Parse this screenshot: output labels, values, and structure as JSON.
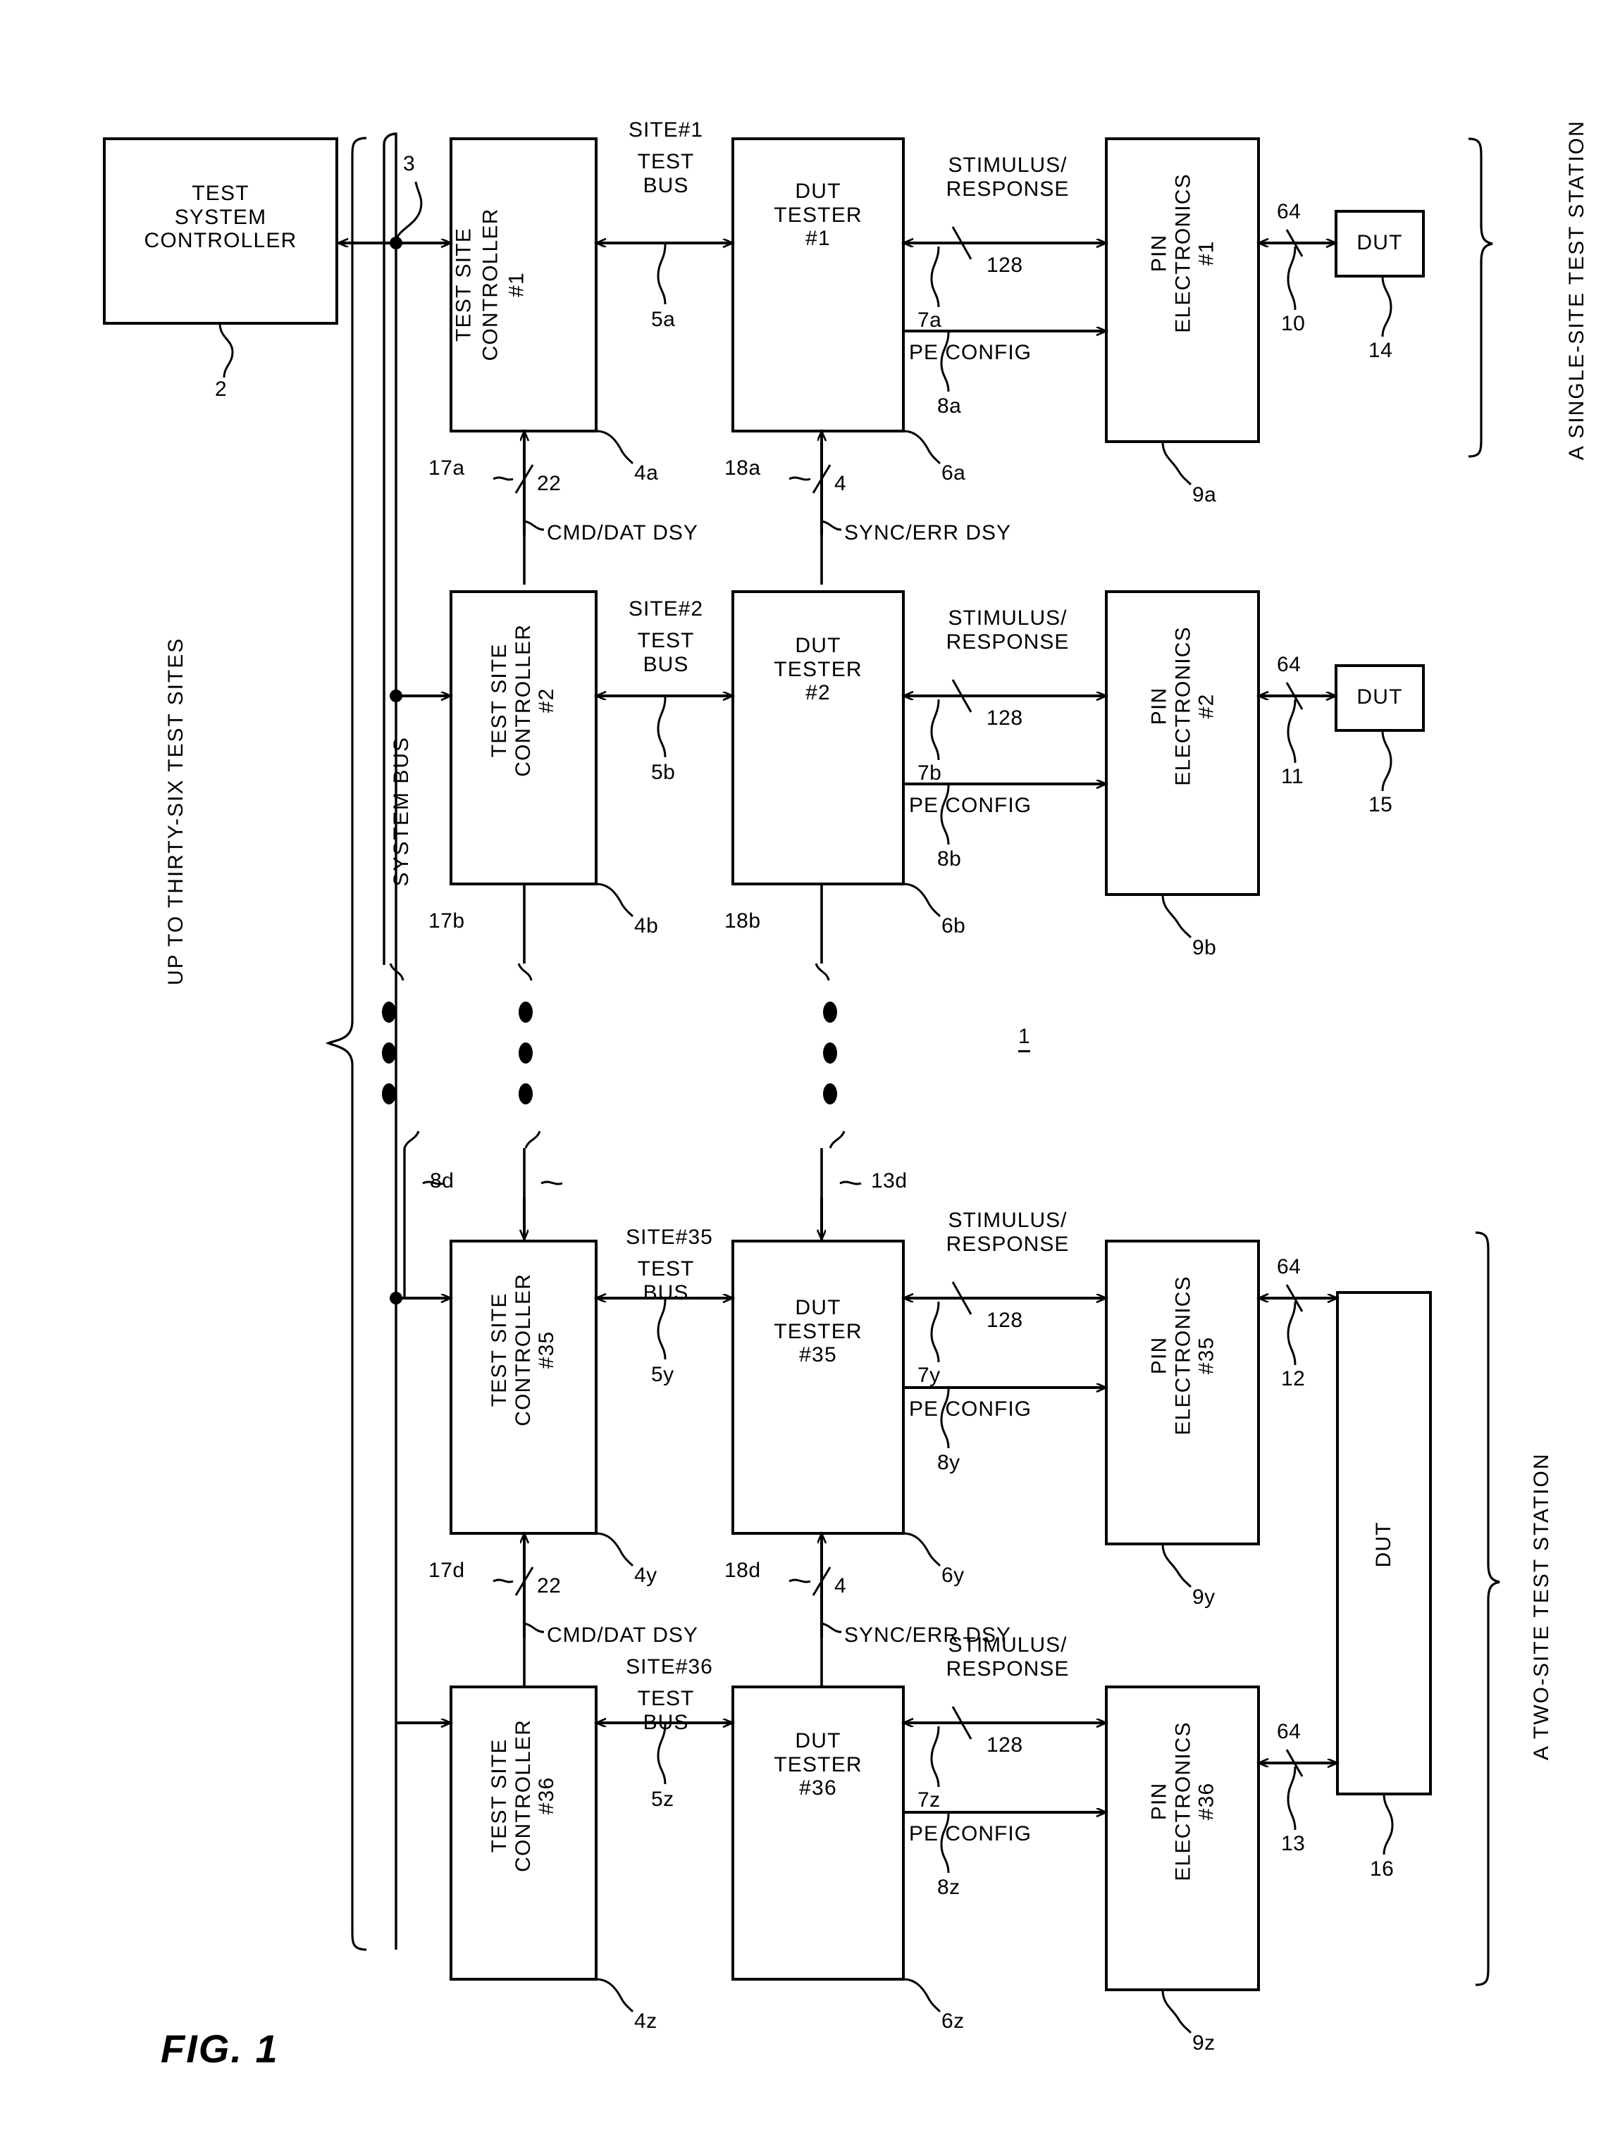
{
  "figure": {
    "caption": "FIG. 1",
    "system_ref": "1"
  },
  "system_controller": {
    "label": "TEST\nSYSTEM\nCONTROLLER",
    "ref": "2"
  },
  "system_bus": {
    "label": "SYSTEM BUS",
    "ref": "3",
    "sites_label": "UP TO THIRTY-SIX TEST SITES"
  },
  "signals": {
    "site_test_bus": "TEST\nBUS",
    "stimulus_response": "STIMULUS/\nRESPONSE",
    "stimulus_width": "128",
    "pe_config": "PE CONFIG",
    "dut_width": "64",
    "cmd_dat_dsy": "CMD/DAT DSY",
    "sync_err_dsy": "SYNC/ERR DSY",
    "cmd_dat_width": "22",
    "sync_err_width": "4",
    "dut_label": "DUT"
  },
  "stations": {
    "single": "A SINGLE-SITE TEST STATION",
    "two": "A TWO-SITE TEST STATION"
  },
  "rows": [
    {
      "site_title": "SITE#1",
      "controller": "TEST SITE\nCONTROLLER\n#1",
      "controller_ref": "4a",
      "tester": "DUT\nTESTER\n#1",
      "tester_ref": "6a",
      "pin": "PIN\nELECTRONICS\n#1",
      "pin_ref": "9a",
      "bus_ref": "5a",
      "sr_ref": "7a",
      "pe_ref": "8a",
      "dut_ref": "10",
      "dut": "DUT",
      "dut_block_ref": "14",
      "dsy_cmd_ref": "17a",
      "dsy_sync_ref": "18a"
    },
    {
      "site_title": "SITE#2",
      "controller": "TEST SITE\nCONTROLLER\n#2",
      "controller_ref": "4b",
      "tester": "DUT\nTESTER\n#2",
      "tester_ref": "6b",
      "pin": "PIN\nELECTRONICS\n#2",
      "pin_ref": "9b",
      "bus_ref": "5b",
      "sr_ref": "7b",
      "pe_ref": "8b",
      "dut_ref": "11",
      "dut": "DUT",
      "dut_block_ref": "15",
      "dsy_cmd_ref": "17b",
      "dsy_sync_ref": "18b"
    },
    {
      "site_title": "SITE#35",
      "controller": "TEST SITE\nCONTROLLER\n#35",
      "controller_ref": "4y",
      "tester": "DUT\nTESTER\n#35",
      "tester_ref": "6y",
      "pin": "PIN\nELECTRONICS\n#35",
      "pin_ref": "9y",
      "bus_ref": "5y",
      "sr_ref": "7y",
      "pe_ref": "8y",
      "dut_ref": "12",
      "dut": "DUT",
      "dut_block_ref": "16",
      "dsy_cmd_ref": "17d",
      "dsy_sync_ref": "18d"
    },
    {
      "site_title": "SITE#36",
      "controller": "TEST SITE\nCONTROLLER\n#36",
      "controller_ref": "4z",
      "tester": "DUT\nTESTER\n#36",
      "tester_ref": "6z",
      "pin": "PIN\nELECTRONICS\n#36",
      "pin_ref": "9z",
      "bus_ref": "5z",
      "sr_ref": "7z",
      "pe_ref": "8z",
      "dut_ref": "13",
      "dut": "DUT",
      "dut_block_ref": "",
      "dsy_cmd_ref": "",
      "dsy_sync_ref": ""
    }
  ],
  "ellipsis_refs": {
    "cmd": "8d",
    "sync": "13d"
  },
  "dsy_row_labels": {
    "cmd_width": "22",
    "sync_width": "4"
  }
}
